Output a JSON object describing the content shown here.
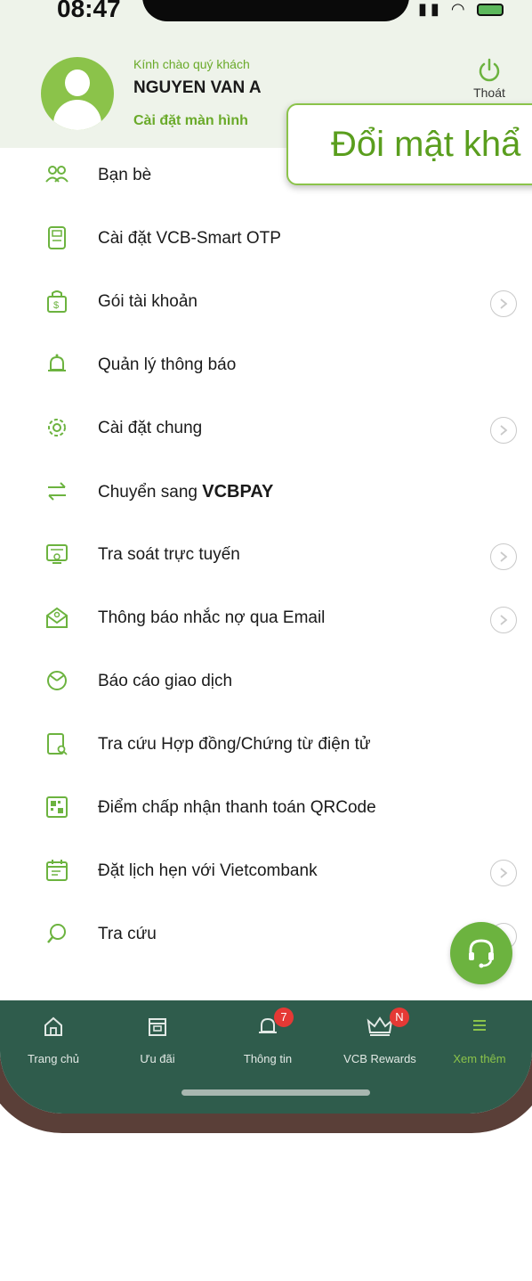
{
  "status_bar": {
    "time": "08:47"
  },
  "header": {
    "greeting": "Kính chào quý khách",
    "user_name": "NGUYEN VAN A",
    "screen_settings": "Cài đặt màn hình",
    "logout_label": "Thoát"
  },
  "callout": {
    "text": "Đổi mật khẩ"
  },
  "menu": {
    "items": [
      {
        "label": "Bạn bè",
        "icon": "friends-icon",
        "chevron": false
      },
      {
        "label": "Cài đặt VCB-Smart OTP",
        "icon": "otp-device-icon",
        "chevron": false
      },
      {
        "label": "Gói tài khoản",
        "icon": "account-package-icon",
        "chevron": true
      },
      {
        "label": "Quản lý thông báo",
        "icon": "bell-icon",
        "chevron": false
      },
      {
        "label": "Cài đặt chung",
        "icon": "gear-icon",
        "chevron": true
      },
      {
        "label_prefix": "Chuyển sang ",
        "label_bold": "VCBPAY",
        "icon": "swap-arrows-icon",
        "chevron": false
      },
      {
        "label": "Tra soát trực tuyến",
        "icon": "online-inquiry-icon",
        "chevron": true
      },
      {
        "label": "Thông báo nhắc nợ qua Email",
        "icon": "email-reminder-icon",
        "chevron": true
      },
      {
        "label": "Báo cáo giao dịch",
        "icon": "pie-chart-icon",
        "chevron": false
      },
      {
        "label": "Tra cứu Hợp đồng/Chứng từ điện tử",
        "icon": "document-search-icon",
        "chevron": false
      },
      {
        "label": "Điểm chấp nhận thanh toán QRCode",
        "icon": "qr-code-icon",
        "chevron": false
      },
      {
        "label": "Đặt lịch hẹn với Vietcombank",
        "icon": "calendar-icon",
        "chevron": true
      },
      {
        "label": "Tra cứu",
        "icon": "search-icon",
        "chevron": true
      }
    ]
  },
  "bottom_nav": {
    "items": [
      {
        "label": "Trang chủ",
        "icon": "home-icon"
      },
      {
        "label": "Ưu đãi",
        "icon": "gift-box-icon"
      },
      {
        "label": "Thông tin",
        "icon": "bell-icon",
        "badge": "7"
      },
      {
        "label": "VCB Rewards",
        "icon": "crown-icon",
        "badge": "N"
      },
      {
        "label": "Xem thêm",
        "icon": "menu-icon",
        "active": true
      }
    ]
  },
  "colors": {
    "accent_green": "#6cb33f",
    "nav_background": "#2f5c4c",
    "badge_red": "#e53935"
  }
}
